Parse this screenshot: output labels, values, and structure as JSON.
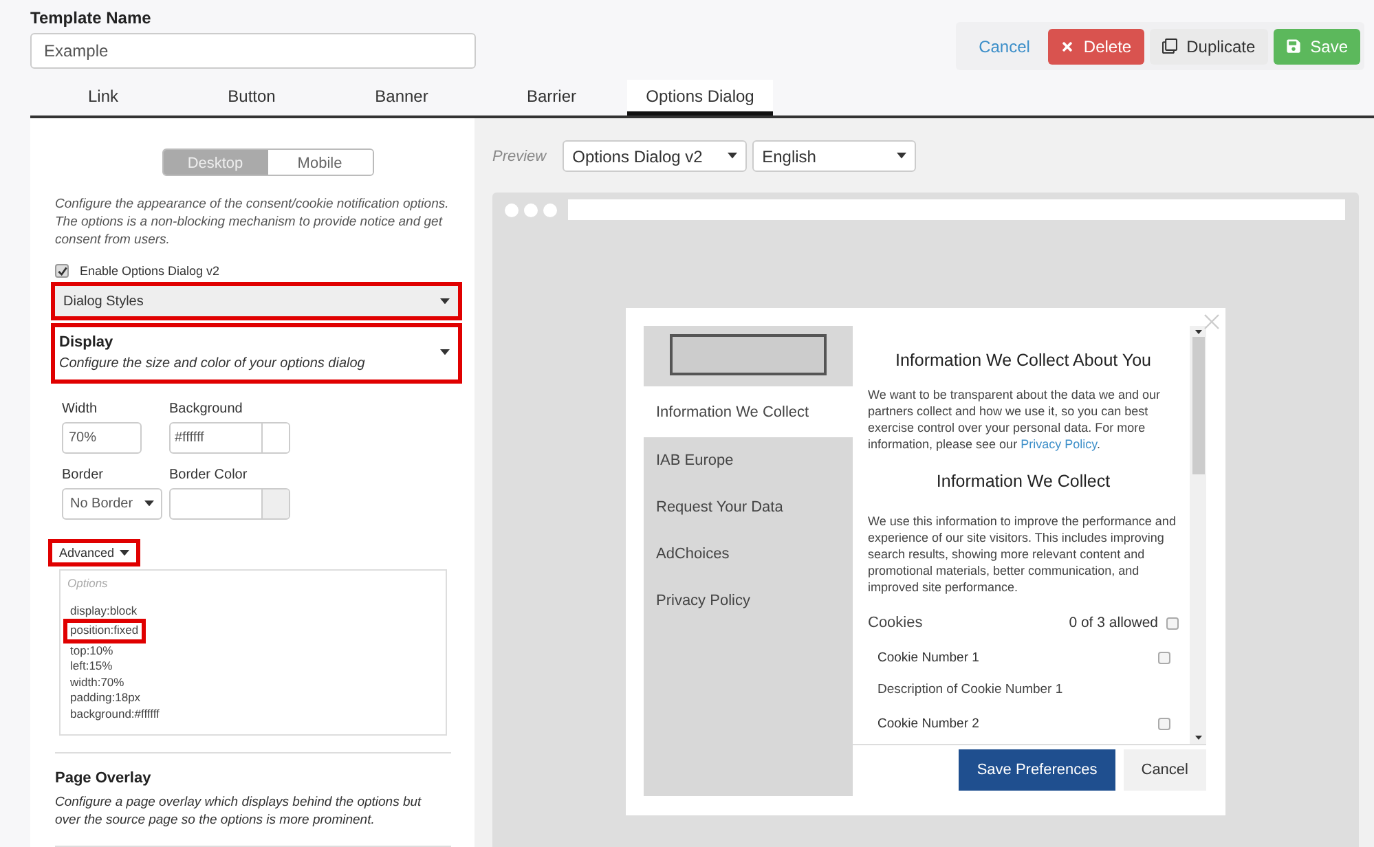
{
  "template_name": {
    "label": "Template Name",
    "value": "Example"
  },
  "actions": [
    {
      "label": "Cancel",
      "kind": "link"
    },
    {
      "label": "Delete",
      "kind": "danger"
    },
    {
      "label": "Duplicate",
      "kind": "default"
    },
    {
      "label": "Save",
      "kind": "success"
    }
  ],
  "tabs": [
    {
      "label": "Link",
      "selected": false
    },
    {
      "label": "Button",
      "selected": false
    },
    {
      "label": "Banner",
      "selected": false
    },
    {
      "label": "Barrier",
      "selected": false
    },
    {
      "label": "Options Dialog",
      "selected": true
    }
  ],
  "device_toggle": [
    {
      "label": "Desktop",
      "selected": true
    },
    {
      "label": "Mobile",
      "selected": false
    }
  ],
  "description": "Configure the appearance of the consent/cookie notification options. The options is a non-blocking mechanism to provide notice and get consent from users.",
  "enable_option": {
    "label": "Enable Options Dialog v2",
    "checked": true
  },
  "style_select": {
    "value": "Dialog Styles",
    "highlighted": true
  },
  "display_section": {
    "title": "Display",
    "description": "Configure the size and color of your options dialog",
    "highlighted": true
  },
  "fields": [
    {
      "label": "Width",
      "kind": "text",
      "value": "70%"
    },
    {
      "label": "Background",
      "kind": "color",
      "value": "#ffffff"
    },
    {
      "label": "Border",
      "kind": "select",
      "value": "No Border"
    },
    {
      "label": "Border Color",
      "kind": "color"
    }
  ],
  "advanced": {
    "label": "Advanced",
    "highlighted": true,
    "options_label": "Options",
    "lines": [
      {
        "text": "display:block",
        "highlighted": false
      },
      {
        "text": "position:fixed",
        "highlighted": true
      },
      {
        "text": "top:10%",
        "highlighted": false
      },
      {
        "text": "left:15%",
        "highlighted": false
      },
      {
        "text": "width:70%",
        "highlighted": false
      },
      {
        "text": "padding:18px",
        "highlighted": false
      },
      {
        "text": "background:#ffffff",
        "highlighted": false
      }
    ]
  },
  "page_overlay": {
    "title": "Page Overlay",
    "description": "Configure a page overlay which displays behind the options but over the source page so the options is more prominent."
  },
  "preview": {
    "label": "Preview",
    "selects": [
      "Options Dialog v2",
      "English"
    ],
    "dialog": {
      "nav": [
        {
          "label": "Information We Collect",
          "selected": true
        },
        {
          "label": "IAB Europe",
          "selected": false
        },
        {
          "label": "Request Your Data",
          "selected": false
        },
        {
          "label": "AdChoices",
          "selected": false
        },
        {
          "label": "Privacy Policy",
          "selected": false
        }
      ],
      "title": "Information We Collect About You",
      "intro": {
        "text": "We want to be transparent about the data we and our partners collect and how we use it, so you can best exercise control over your personal data. For more information, please see our ",
        "link": "Privacy Policy",
        "after": "."
      },
      "subtitle": "Information We Collect",
      "body": "We use this information to improve the performance and experience of our site visitors. This includes improving search results, showing more relevant content and promotional materials, better communication, and improved site performance.",
      "cookies": {
        "label": "Cookies",
        "count": "0 of 3 allowed",
        "checked": false,
        "items": [
          {
            "name": "Cookie Number 1",
            "checked": false,
            "description": "Description of Cookie Number 1"
          },
          {
            "name": "Cookie Number 2",
            "checked": false
          }
        ]
      },
      "buttons": [
        {
          "label": "Save Preferences",
          "kind": "primary"
        },
        {
          "label": "Cancel",
          "kind": "secondary"
        }
      ]
    }
  }
}
